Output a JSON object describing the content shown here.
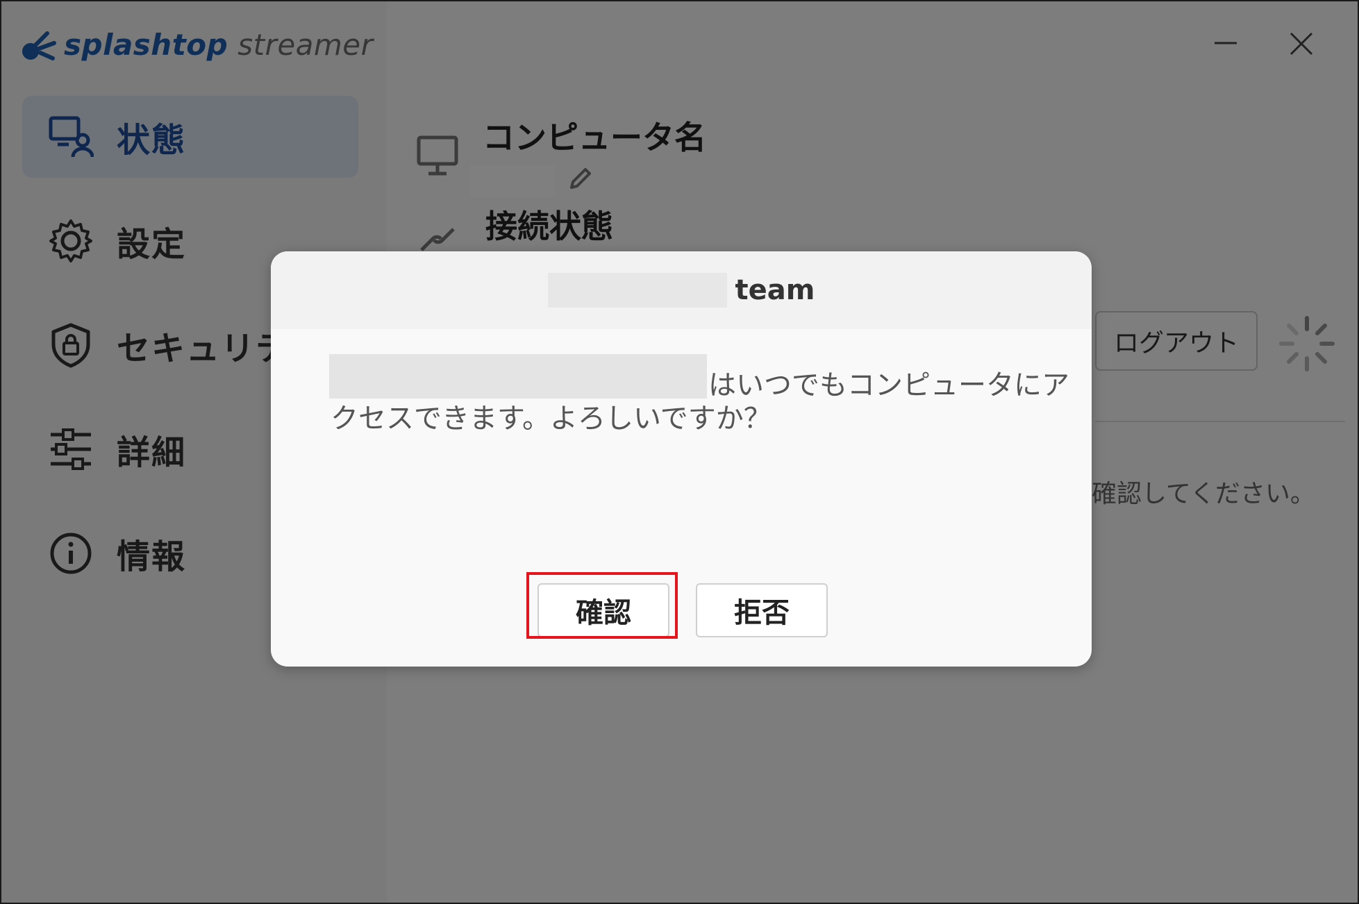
{
  "app": {
    "brand": "splashtop",
    "product": "streamer"
  },
  "window_controls": {
    "minimize_icon": "minimize-icon",
    "close_icon": "close-icon"
  },
  "sidebar": {
    "items": [
      {
        "label": "状態",
        "icon": "status-monitor-icon",
        "active": true
      },
      {
        "label": "設定",
        "icon": "gear-icon",
        "active": false
      },
      {
        "label": "セキュリティ",
        "icon": "shield-lock-icon",
        "active": false
      },
      {
        "label": "詳細",
        "icon": "sliders-icon",
        "active": false
      },
      {
        "label": "情報",
        "icon": "info-icon",
        "active": false
      }
    ]
  },
  "main": {
    "computer_name_title": "コンピュータ名",
    "connection_status_title": "接続状態",
    "connection_status_text": "",
    "logout_label": "ログアウト",
    "hint_text": "確認してください。"
  },
  "dialog": {
    "title_suffix": "team",
    "message_line1": "はいつでもコンピュータにア",
    "message_line2": "クセスできます。よろしいですか？",
    "confirm_label": "確認",
    "reject_label": "拒否"
  },
  "colors": {
    "brand_blue": "#1f5fb0",
    "active_nav_bg": "#dce6f4",
    "highlight_red": "#e8141c",
    "overlay": "rgba(0,0,0,0.5)"
  }
}
